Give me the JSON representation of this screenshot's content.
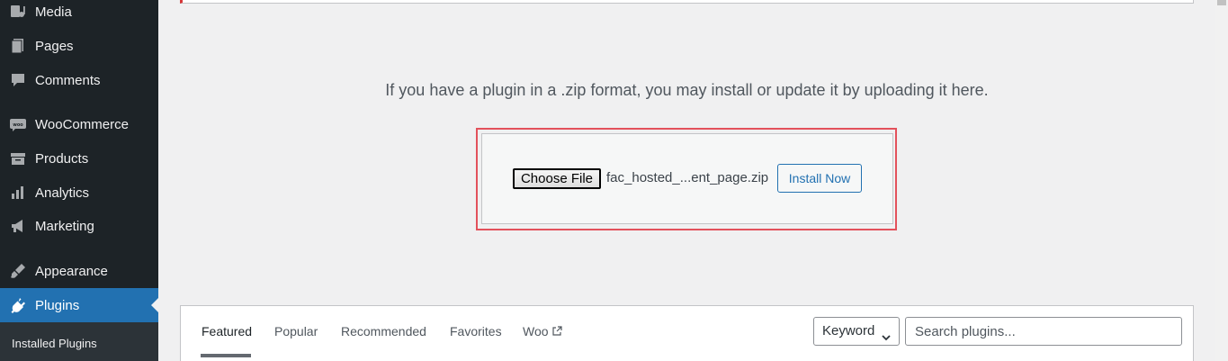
{
  "sidebar": {
    "items": [
      {
        "label": "Media",
        "icon": "media-icon"
      },
      {
        "label": "Pages",
        "icon": "pages-icon"
      },
      {
        "label": "Comments",
        "icon": "comments-icon"
      },
      {
        "label": "WooCommerce",
        "icon": "woocommerce-icon"
      },
      {
        "label": "Products",
        "icon": "products-icon"
      },
      {
        "label": "Analytics",
        "icon": "analytics-icon"
      },
      {
        "label": "Marketing",
        "icon": "marketing-icon"
      },
      {
        "label": "Appearance",
        "icon": "appearance-icon"
      },
      {
        "label": "Plugins",
        "icon": "plugins-icon",
        "current": true
      }
    ],
    "submenu": {
      "label": "Installed Plugins"
    }
  },
  "upload": {
    "description": "If you have a plugin in a .zip format, you may install or update it by uploading it here.",
    "choose_file_label": "Choose File",
    "file_name": "fac_hosted_...ent_page.zip",
    "install_label": "Install Now"
  },
  "filter": {
    "tabs": [
      {
        "label": "Featured",
        "current": true
      },
      {
        "label": "Popular"
      },
      {
        "label": "Recommended"
      },
      {
        "label": "Favorites"
      },
      {
        "label": "Woo",
        "external": true
      }
    ],
    "search_type": "Keyword",
    "search_placeholder": "Search plugins..."
  },
  "colors": {
    "sidebar_bg": "#1d2327",
    "accent": "#2271b1",
    "highlight_border": "#e3515b"
  }
}
